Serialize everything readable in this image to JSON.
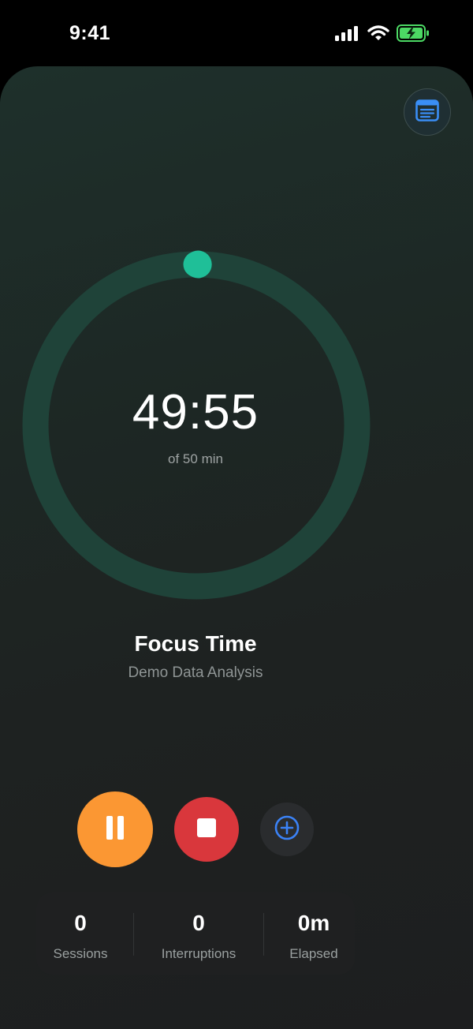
{
  "status_bar": {
    "time": "9:41"
  },
  "timer": {
    "remaining": "49:55",
    "total_label": "of 50 min",
    "progress_fraction": 0.0017
  },
  "session": {
    "mode": "Focus Time",
    "task": "Demo Data Analysis"
  },
  "stats": [
    {
      "value": "0",
      "label": "Sessions"
    },
    {
      "value": "0",
      "label": "Interruptions"
    },
    {
      "value": "0m",
      "label": "Elapsed"
    }
  ],
  "icons": {
    "notes": "notes-icon",
    "pause": "pause-icon",
    "stop": "stop-icon",
    "add": "plus-circle-icon"
  },
  "colors": {
    "accent": "#1fbf98",
    "ring_track": "#1f4339",
    "pause": "#fb9733",
    "stop": "#d9373c",
    "add_icon": "#3b82f6",
    "battery": "#4cd964"
  }
}
